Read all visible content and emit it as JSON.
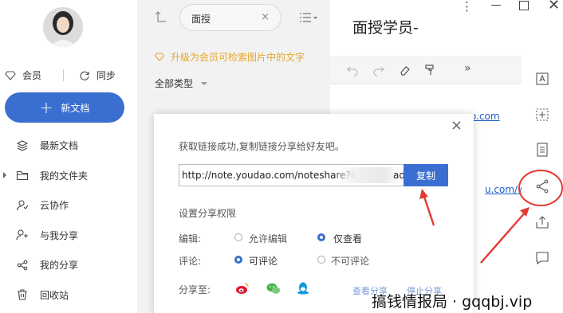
{
  "sidebar": {
    "member_label": "会员",
    "sync_label": "同步",
    "new_doc_label": "新文档",
    "items": [
      {
        "label": "最新文档",
        "icon": "layers-icon"
      },
      {
        "label": "我的文件夹",
        "icon": "folder-icon"
      },
      {
        "label": "云协作",
        "icon": "collab-icon"
      },
      {
        "label": "与我分享",
        "icon": "shared-with-me-icon"
      },
      {
        "label": "我的分享",
        "icon": "share-icon"
      },
      {
        "label": "回收站",
        "icon": "trash-icon"
      }
    ]
  },
  "list": {
    "search_value": "面授",
    "upgrade_tip": "升级为会员可检索图片中的文字",
    "type_filter": "全部类型"
  },
  "editor": {
    "title": "面授学员-",
    "links": [
      "o.com",
      "u.com/w"
    ]
  },
  "dialog": {
    "message": "获取链接成功,复制链接分享给好友吧。",
    "link_value": "http://note.youdao.com/noteshare?id=",
    "link_tail": "ad",
    "copy_label": "复制",
    "permission_title": "设置分享权限",
    "edit_label": "编辑:",
    "edit_options": [
      "允许编辑",
      "仅查看"
    ],
    "edit_selected": 1,
    "comment_label": "评论:",
    "comment_options": [
      "可评论",
      "不可评论"
    ],
    "comment_selected": 0,
    "share_to_label": "分享至:",
    "share_targets": [
      "weibo-icon",
      "wechat-icon",
      "qq-icon"
    ],
    "footer_links": [
      "查看分享",
      "停止分享"
    ]
  },
  "watermark": "搞钱情报局 · gqqbj.vip",
  "colors": {
    "accent": "#3a6fd1",
    "tip": "#e5a62b",
    "annotation": "#e53935"
  }
}
